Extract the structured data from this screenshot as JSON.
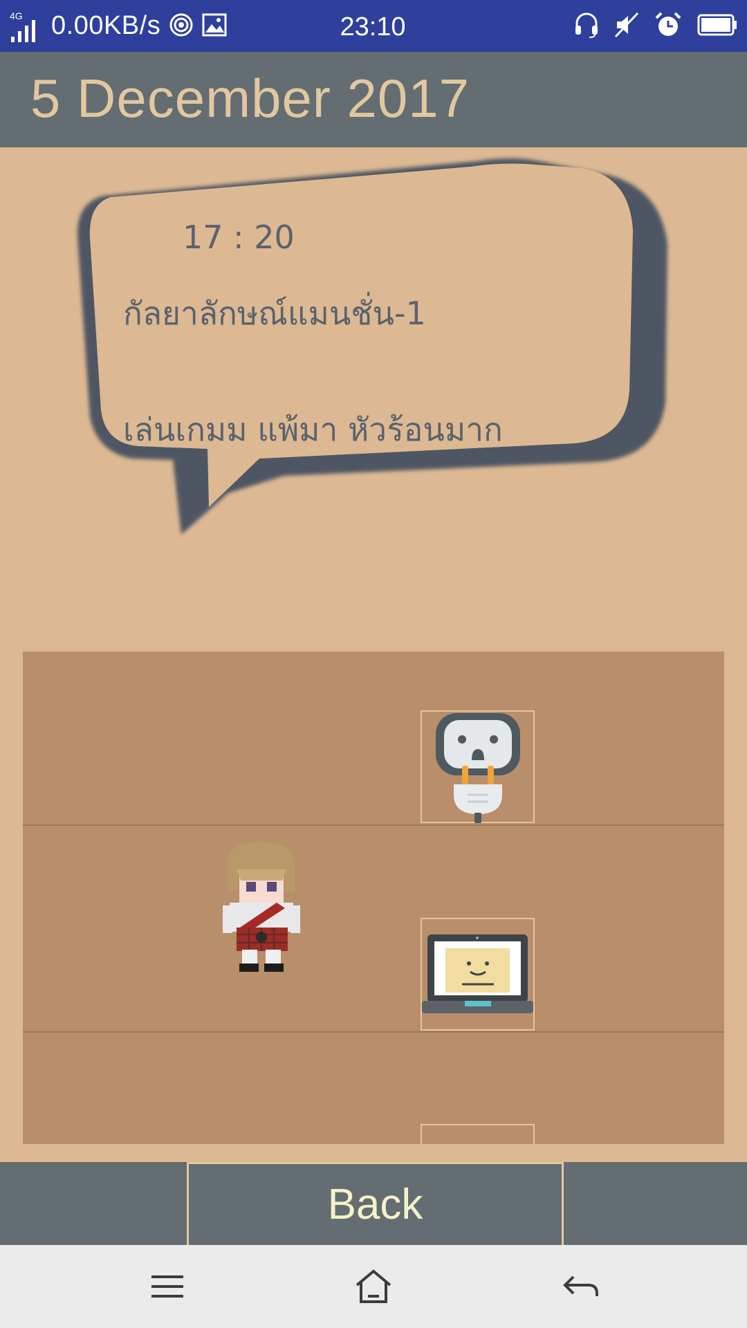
{
  "status_bar": {
    "network": "4G",
    "speed": "0.00KB/s",
    "time": "23:10"
  },
  "header": {
    "date": "5 December 2017"
  },
  "entry": {
    "time": "17 : 20",
    "location": "กัลยาลักษณ์แมนชั่น-1",
    "note": "เล่นเกมม แพ้มา หัวร้อนมาก"
  },
  "footer": {
    "back_label": "Back"
  },
  "colors": {
    "status_bar": "#2f3f9c",
    "header": "#636d72",
    "background": "#dcb993",
    "room": "#b98e6b",
    "bubble_outline": "#4f5664",
    "title_text": "#e2c79f",
    "button_text": "#f4f2c9"
  },
  "icons": {
    "status_left": [
      "signal-icon",
      "hotspot-icon",
      "image-icon"
    ],
    "status_right": [
      "headset-icon",
      "mute-icon",
      "alarm-icon",
      "battery-icon"
    ],
    "room_items": [
      "power-plug-icon",
      "laptop-icon"
    ],
    "character": "pixel-character-sprite",
    "nav": [
      "menu-icon",
      "home-icon",
      "back-arrow-icon"
    ]
  }
}
